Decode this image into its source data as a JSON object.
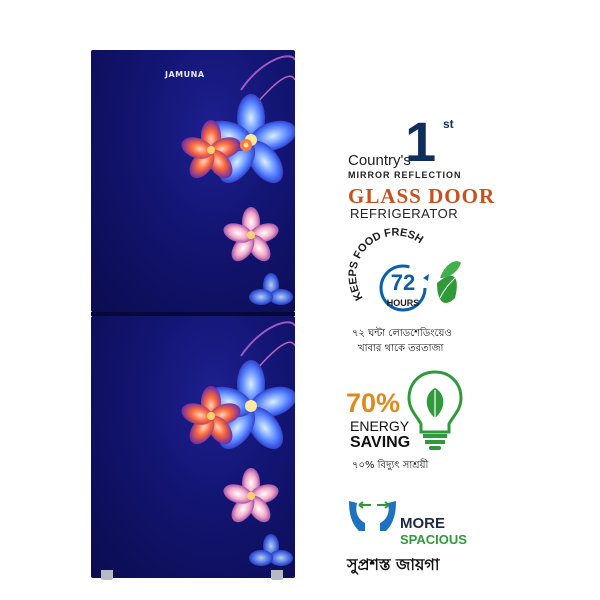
{
  "product": {
    "brand": "JAMUNA"
  },
  "features": {
    "first": {
      "countrys": "Country's",
      "rank_number": "1",
      "rank_suffix": "st",
      "mirror": "MIRROR REFLECTION",
      "glass_door": "GLASS DOOR",
      "refrigerator": "REFRIGERATOR"
    },
    "fresh": {
      "arc_text": "KEEPS FOOD FRESH",
      "hours_number": "72",
      "hours_label": "HOURS",
      "bengali_line1": "৭২ ঘন্টা লোডশেডিংয়েও",
      "bengali_line2": "খাবার থাকে তরতাজা"
    },
    "energy": {
      "percent": "70%",
      "energy": "ENERGY",
      "saving": "SAVING",
      "bengali": "৭০% বিদ্যুৎ সাশ্রয়ী"
    },
    "space": {
      "more": "MORE",
      "spacious": "SPACIOUS",
      "bengali": "সুপ্রশস্ত জায়গা"
    }
  },
  "colors": {
    "door_blue": "#121470",
    "accent_green": "#2f9a3a",
    "accent_orange": "#e08a1e",
    "glass_door_orange": "#c8501c",
    "hours_blue": "#0b5fa8"
  }
}
